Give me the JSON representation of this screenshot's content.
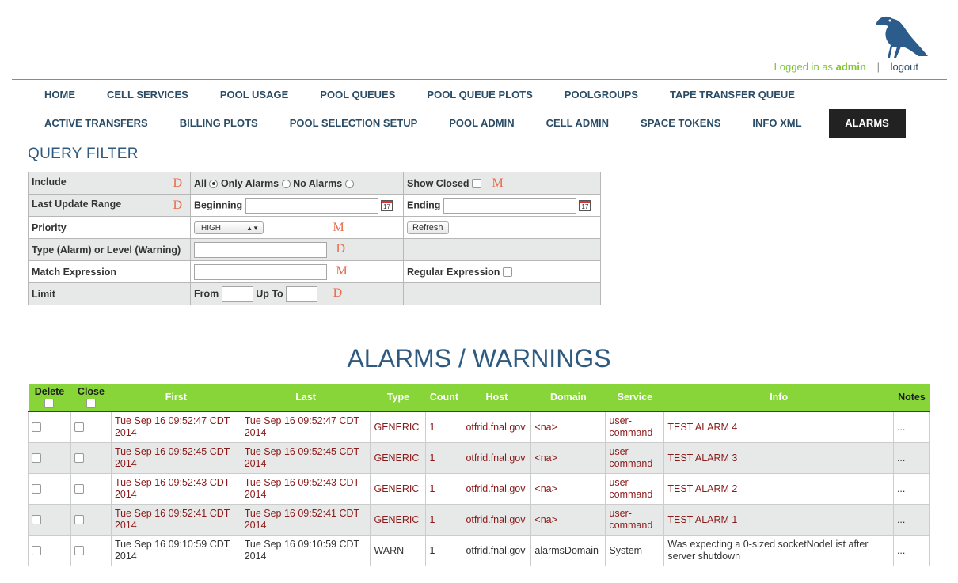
{
  "header": {
    "logged_in_label": "Logged in as",
    "username": "admin",
    "separator": "|",
    "logout_label": "logout"
  },
  "nav": {
    "row1": [
      "HOME",
      "CELL SERVICES",
      "POOL USAGE",
      "POOL QUEUES",
      "POOL QUEUE PLOTS",
      "POOLGROUPS",
      "TAPE TRANSFER QUEUE"
    ],
    "row2": [
      "ACTIVE TRANSFERS",
      "BILLING PLOTS",
      "POOL SELECTION SETUP",
      "POOL ADMIN",
      "CELL ADMIN",
      "SPACE TOKENS",
      "INFO XML",
      "ALARMS"
    ],
    "active": "ALARMS"
  },
  "filter": {
    "title": "QUERY FILTER",
    "include_label": "Include",
    "include_options": [
      "All",
      "Only Alarms",
      "No Alarms"
    ],
    "include_selected": "All",
    "show_closed_label": "Show Closed",
    "last_update_label": "Last Update Range",
    "beginning_label": "Beginning",
    "ending_label": "Ending",
    "calendar_day": "17",
    "priority_label": "Priority",
    "priority_value": "HIGH",
    "refresh_label": "Refresh",
    "type_label": "Type (Alarm) or Level (Warning)",
    "match_label": "Match Expression",
    "regex_label": "Regular Expression",
    "limit_label": "Limit",
    "from_label": "From",
    "upto_label": "Up To",
    "markers": {
      "D": "D",
      "M": "M"
    }
  },
  "alarms_title": "ALARMS / WARNINGS",
  "alarms_table": {
    "columns": [
      "Delete",
      "Close",
      "First",
      "Last",
      "Type",
      "Count",
      "Host",
      "Domain",
      "Service",
      "Info",
      "Notes"
    ],
    "rows": [
      {
        "first": "Tue Sep 16 09:52:47 CDT 2014",
        "last": "Tue Sep 16 09:52:47 CDT 2014",
        "type": "GENERIC",
        "count": "1",
        "host": "otfrid.fnal.gov",
        "domain": "<na>",
        "service": "user-command",
        "info": "TEST ALARM 4",
        "notes": "..."
      },
      {
        "first": "Tue Sep 16 09:52:45 CDT 2014",
        "last": "Tue Sep 16 09:52:45 CDT 2014",
        "type": "GENERIC",
        "count": "1",
        "host": "otfrid.fnal.gov",
        "domain": "<na>",
        "service": "user-command",
        "info": "TEST ALARM 3",
        "notes": "..."
      },
      {
        "first": "Tue Sep 16 09:52:43 CDT 2014",
        "last": "Tue Sep 16 09:52:43 CDT 2014",
        "type": "GENERIC",
        "count": "1",
        "host": "otfrid.fnal.gov",
        "domain": "<na>",
        "service": "user-command",
        "info": "TEST ALARM 2",
        "notes": "..."
      },
      {
        "first": "Tue Sep 16 09:52:41 CDT 2014",
        "last": "Tue Sep 16 09:52:41 CDT 2014",
        "type": "GENERIC",
        "count": "1",
        "host": "otfrid.fnal.gov",
        "domain": "<na>",
        "service": "user-command",
        "info": "TEST ALARM 1",
        "notes": "..."
      },
      {
        "first": "Tue Sep 16 09:10:59 CDT 2014",
        "last": "Tue Sep 16 09:10:59 CDT 2014",
        "type": "WARN",
        "count": "1",
        "host": "otfrid.fnal.gov",
        "domain": "alarmsDomain",
        "service": "System",
        "info": "Was expecting a 0-sized socketNodeList after server shutdown",
        "notes": "..."
      }
    ]
  },
  "colors": {
    "accent_blue": "#2e5a80",
    "nav_text": "#2a4c66",
    "header_green": "#87d539",
    "alarm_red": "#8b1a1a",
    "marker_orange": "#e86a4b"
  }
}
